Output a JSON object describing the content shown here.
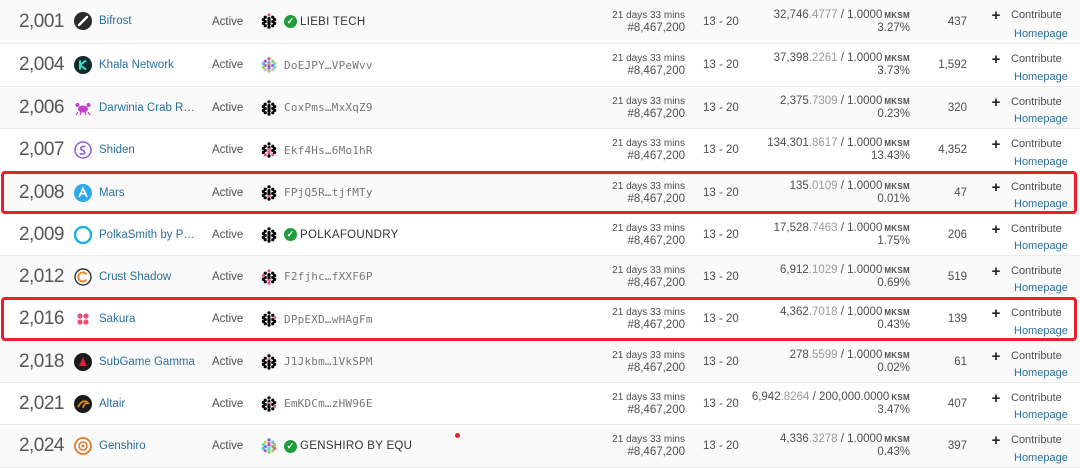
{
  "rows": [
    {
      "para_id": "2,001",
      "name": "Bifrost",
      "logo": "bifrost-logo",
      "logo_color": "#2b2b2b",
      "status": "Active",
      "depositor": "LIEBI TECH",
      "verified": true,
      "ending_time": "21 days 33 mins",
      "ending_block": "#8,467,200",
      "leases": "13 - 20",
      "raised_int": "32,746",
      "raised_dec": ".4777",
      "cap": " / 1.0000",
      "unit": "MKSM",
      "percent": "3.27%",
      "contributors": "437",
      "contribute_label": "Contribute",
      "homepage_label": "Homepage"
    },
    {
      "para_id": "2,004",
      "name": "Khala Network",
      "logo": "khala-logo",
      "logo_color": "#0f2c2c",
      "status": "Active",
      "depositor": "DoEJPY…VPeWvv",
      "verified": false,
      "ending_time": "21 days 33 mins",
      "ending_block": "#8,467,200",
      "leases": "13 - 20",
      "raised_int": "37,398",
      "raised_dec": ".2261",
      "cap": " / 1.0000",
      "unit": "MKSM",
      "percent": "3.73%",
      "contributors": "1,592",
      "contribute_label": "Contribute",
      "homepage_label": "Homepage"
    },
    {
      "para_id": "2,006",
      "name": "Darwinia Crab Redi…",
      "logo": "crab-logo",
      "logo_color": "#c640c9",
      "status": "Active",
      "depositor": "CoxPms…MxXqZ9",
      "verified": false,
      "ending_time": "21 days 33 mins",
      "ending_block": "#8,467,200",
      "leases": "13 - 20",
      "raised_int": "2,375",
      "raised_dec": ".7309",
      "cap": " / 1.0000",
      "unit": "MKSM",
      "percent": "0.23%",
      "contributors": "320",
      "contribute_label": "Contribute",
      "homepage_label": "Homepage"
    },
    {
      "para_id": "2,007",
      "name": "Shiden",
      "logo": "shiden-logo",
      "logo_color": "#8a5fdd",
      "status": "Active",
      "depositor": "Ekf4Hs…6Mo1hR",
      "verified": false,
      "ending_time": "21 days 33 mins",
      "ending_block": "#8,467,200",
      "leases": "13 - 20",
      "raised_int": "134,301",
      "raised_dec": ".8617",
      "cap": " / 1.0000",
      "unit": "MKSM",
      "percent": "13.43%",
      "contributors": "4,352",
      "contribute_label": "Contribute",
      "homepage_label": "Homepage"
    },
    {
      "para_id": "2,008",
      "name": "Mars",
      "logo": "mars-logo",
      "logo_color": "#2da8e8",
      "status": "Active",
      "depositor": "FPjQ5R…tjfMTy",
      "verified": false,
      "ending_time": "21 days 33 mins",
      "ending_block": "#8,467,200",
      "leases": "13 - 20",
      "raised_int": "135",
      "raised_dec": ".0109",
      "cap": " / 1.0000",
      "unit": "MKSM",
      "percent": "0.01%",
      "contributors": "47",
      "contribute_label": "Contribute",
      "homepage_label": "Homepage"
    },
    {
      "para_id": "2,009",
      "name": "PolkaSmith by Polk…",
      "logo": "polkasmith-logo",
      "logo_color": "#1fb1e0",
      "status": "Active",
      "depositor": "POLKAFOUNDRY",
      "verified": true,
      "ending_time": "21 days 33 mins",
      "ending_block": "#8,467,200",
      "leases": "13 - 20",
      "raised_int": "17,528",
      "raised_dec": ".7463",
      "cap": " / 1.0000",
      "unit": "MKSM",
      "percent": "1.75%",
      "contributors": "206",
      "contribute_label": "Contribute",
      "homepage_label": "Homepage"
    },
    {
      "para_id": "2,012",
      "name": "Crust Shadow",
      "logo": "crust-shadow-logo",
      "logo_color": "#e88a2d",
      "status": "Active",
      "depositor": "F2fjhc…fXXF6P",
      "verified": false,
      "ending_time": "21 days 33 mins",
      "ending_block": "#8,467,200",
      "leases": "13 - 20",
      "raised_int": "6,912",
      "raised_dec": ".1029",
      "cap": " / 1.0000",
      "unit": "MKSM",
      "percent": "0.69%",
      "contributors": "519",
      "contribute_label": "Contribute",
      "homepage_label": "Homepage"
    },
    {
      "para_id": "2,016",
      "name": "Sakura",
      "logo": "sakura-logo",
      "logo_color": "#e8507a",
      "status": "Active",
      "depositor": "DPpEXD…wHAgFm",
      "verified": false,
      "ending_time": "21 days 33 mins",
      "ending_block": "#8,467,200",
      "leases": "13 - 20",
      "raised_int": "4,362",
      "raised_dec": ".7018",
      "cap": " / 1.0000",
      "unit": "MKSM",
      "percent": "0.43%",
      "contributors": "139",
      "contribute_label": "Contribute",
      "homepage_label": "Homepage"
    },
    {
      "para_id": "2,018",
      "name": "SubGame Gamma",
      "logo": "subgame-logo",
      "logo_color": "#d6243a",
      "status": "Active",
      "depositor": "J1Jkbm…1VkSPM",
      "verified": false,
      "ending_time": "21 days 33 mins",
      "ending_block": "#8,467,200",
      "leases": "13 - 20",
      "raised_int": "278",
      "raised_dec": ".5599",
      "cap": " / 1.0000",
      "unit": "MKSM",
      "percent": "0.02%",
      "contributors": "61",
      "contribute_label": "Contribute",
      "homepage_label": "Homepage"
    },
    {
      "para_id": "2,021",
      "name": "Altair",
      "logo": "altair-logo",
      "logo_color": "#d68a1a",
      "status": "Active",
      "depositor": "EmKDCm…zHW96E",
      "verified": false,
      "ending_time": "21 days 33 mins",
      "ending_block": "#8,467,200",
      "leases": "13 - 20",
      "raised_int": "6,942",
      "raised_dec": ".8264",
      "cap": " / 200,000.0000",
      "unit": "KSM",
      "percent": "3.47%",
      "contributors": "407",
      "contribute_label": "Contribute",
      "homepage_label": "Homepage"
    },
    {
      "para_id": "2,024",
      "name": "Genshiro",
      "logo": "genshiro-logo",
      "logo_color": "#e07a2a",
      "status": "Active",
      "depositor": "GENSHIRO BY EQU",
      "verified": true,
      "ending_time": "21 days 33 mins",
      "ending_block": "#8,467,200",
      "leases": "13 - 20",
      "raised_int": "4,336",
      "raised_dec": ".3278",
      "cap": " / 1.0000",
      "unit": "MKSM",
      "percent": "0.43%",
      "contributors": "397",
      "contribute_label": "Contribute",
      "homepage_label": "Homepage"
    }
  ],
  "highlighted_para_ids": [
    "2,008",
    "2,016"
  ],
  "colors": {
    "highlight": "#e8202a",
    "link": "#2b6f9a",
    "verified": "#1f9d3a"
  }
}
